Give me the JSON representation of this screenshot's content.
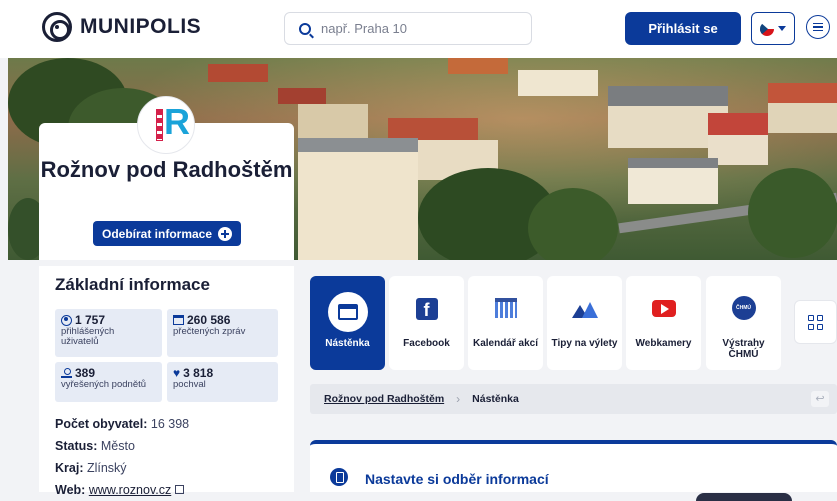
{
  "header": {
    "brand": "MUNIPOLIS",
    "search_placeholder": "např. Praha 10",
    "login_label": "Přihlásit se",
    "language": "CZ"
  },
  "city": {
    "name": "Rožnov pod Radhoštěm",
    "logo_letter": "R",
    "subscribe_label": "Odebírat informace"
  },
  "info": {
    "title": "Základní informace",
    "stats": [
      {
        "value": "1 757",
        "label": "přihlášených uživatelů",
        "icon": "user-icon"
      },
      {
        "value": "260 586",
        "label": "přečtených zpráv",
        "icon": "news-icon"
      },
      {
        "value": "389",
        "label": "vyřešených podnětů",
        "icon": "person-icon"
      },
      {
        "value": "3 818",
        "label": "pochval",
        "icon": "heart-icon"
      }
    ],
    "population_label": "Počet obyvatel:",
    "population_value": "16 398",
    "status_label": "Status:",
    "status_value": "Město",
    "region_label": "Kraj:",
    "region_value": "Zlínský",
    "web_label": "Web:",
    "web_value": "www.roznov.cz"
  },
  "tiles": [
    {
      "label": "Nástěnka",
      "icon": "board-icon",
      "active": true
    },
    {
      "label": "Facebook",
      "icon": "facebook-icon"
    },
    {
      "label": "Kalendář akcí",
      "icon": "calendar-icon"
    },
    {
      "label": "Tipy na výlety",
      "icon": "trip-icon"
    },
    {
      "label": "Webkamery",
      "icon": "youtube-icon"
    },
    {
      "label": "Výstrahy ČHMÚ",
      "icon": "chmu-icon",
      "icon_text": "ČHMÚ"
    }
  ],
  "breadcrumb": {
    "root": "Rožnov pod Radhoštěm",
    "separator": "›",
    "current": "Nástěnka",
    "back_icon": "↩"
  },
  "subscribe_card": {
    "title": "Nastavte si odběr informací"
  },
  "colors": {
    "primary": "#0b3a9a",
    "background": "#f2f3f6",
    "stat_bg": "#e6ebf5"
  }
}
